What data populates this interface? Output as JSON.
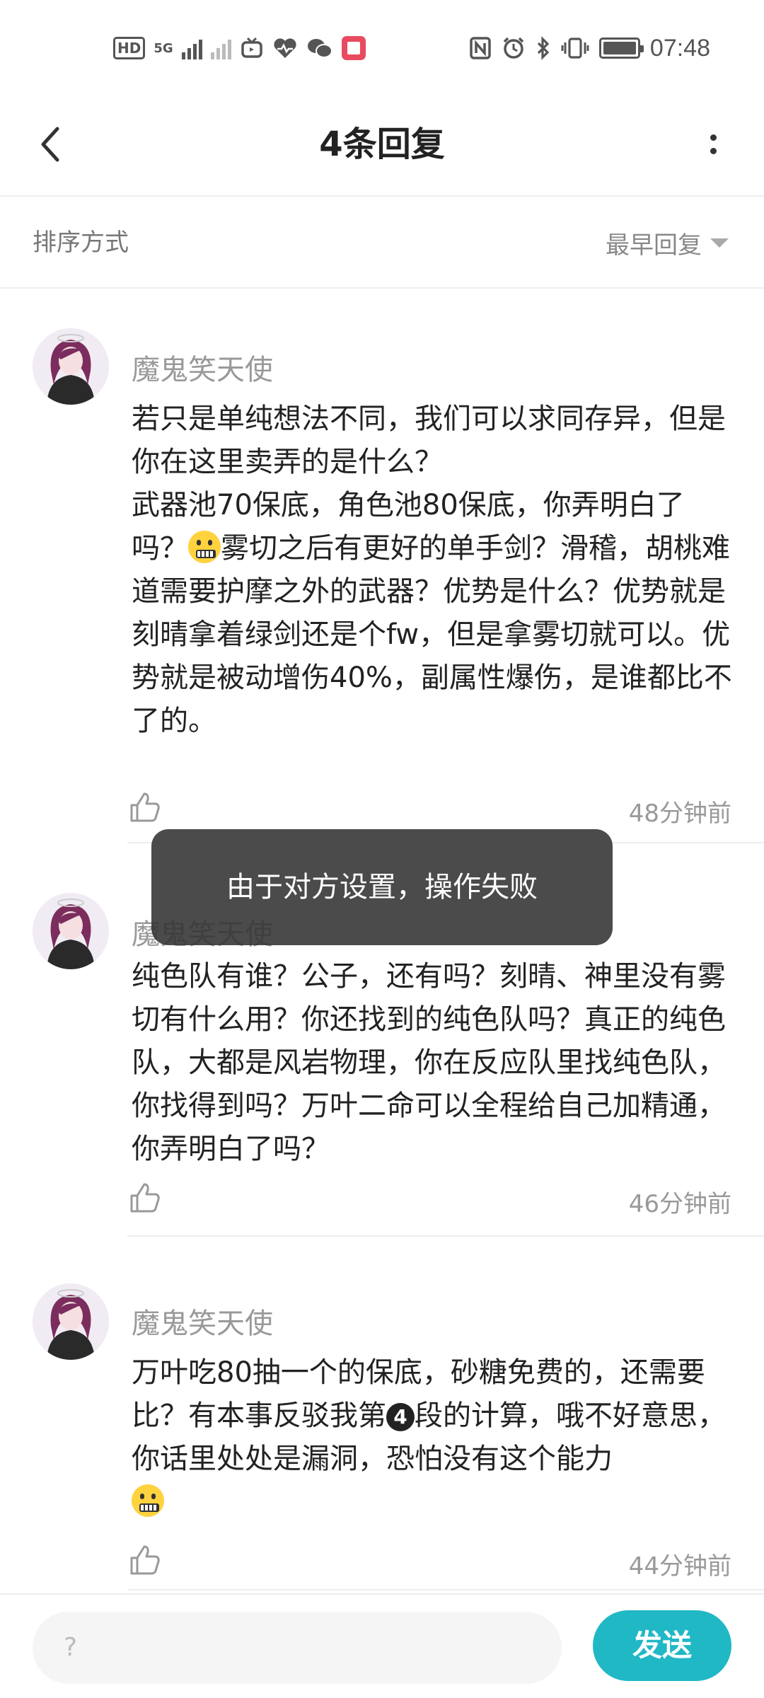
{
  "status_bar": {
    "hd": "HD",
    "network": "5G",
    "time": "07:48"
  },
  "header": {
    "title": "4条回复"
  },
  "sort": {
    "label": "排序方式",
    "selected": "最早回复"
  },
  "replies": [
    {
      "author": "魔鬼笑天使",
      "text_part1": "若只是单纯想法不同，我们可以求同存异，但是你在这里卖弄的是什么？\n武器池70保底，角色池80保底，你弄明白了吗？",
      "text_part2": "雾切之后有更好的单手剑？滑稽，胡桃难道需要护摩之外的武器？优势是什么？优势就是刻晴拿着绿剑还是个fw，但是拿雾切就可以。优势就是被动增伤40%，副属性爆伤，是谁都比不了的。",
      "time": "48分钟前"
    },
    {
      "author": "魔鬼笑天使",
      "text": "纯色队有谁？公子，还有吗？刻晴、神里没有雾切有什么用？你还找到的纯色队吗？真正的纯色队，大都是风岩物理，你在反应队里找纯色队，你找得到吗？万叶二命可以全程给自己加精通，你弄明白了吗？",
      "time": "46分钟前"
    },
    {
      "author": "魔鬼笑天使",
      "text_part1": "万叶吃80抽一个的保底，砂糖免费的，还需要比？有本事反驳我第",
      "circled": "4",
      "text_part2": "段的计算，哦不好意思，你话里处处是漏洞，恐怕没有这个能力",
      "time": "44分钟前"
    }
  ],
  "toast": {
    "message": "由于对方设置，操作失败"
  },
  "input_bar": {
    "placeholder": "?",
    "send_label": "发送"
  },
  "colors": {
    "accent": "#21b8c6",
    "toast_bg": "#323232",
    "avatar_hair": "#7b2d5e"
  }
}
